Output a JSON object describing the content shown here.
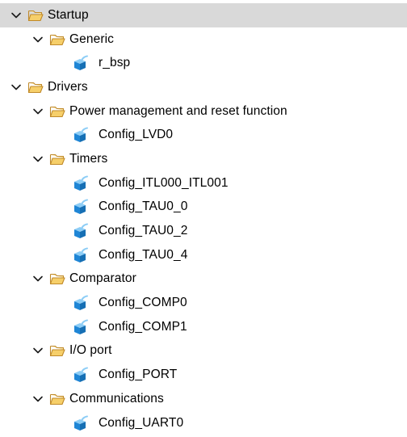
{
  "tree": [
    {
      "label": "Startup",
      "kind": "folder",
      "depth": 0,
      "expanded": true,
      "selected": true
    },
    {
      "label": "Generic",
      "kind": "folder",
      "depth": 1,
      "expanded": true
    },
    {
      "label": "r_bsp",
      "kind": "component",
      "depth": 2
    },
    {
      "label": "Drivers",
      "kind": "folder",
      "depth": 0,
      "expanded": true
    },
    {
      "label": "Power management and reset function",
      "kind": "folder",
      "depth": 1,
      "expanded": true
    },
    {
      "label": "Config_LVD0",
      "kind": "component",
      "depth": 2
    },
    {
      "label": "Timers",
      "kind": "folder",
      "depth": 1,
      "expanded": true
    },
    {
      "label": "Config_ITL000_ITL001",
      "kind": "component",
      "depth": 2
    },
    {
      "label": "Config_TAU0_0",
      "kind": "component",
      "depth": 2
    },
    {
      "label": "Config_TAU0_2",
      "kind": "component",
      "depth": 2
    },
    {
      "label": "Config_TAU0_4",
      "kind": "component",
      "depth": 2
    },
    {
      "label": "Comparator",
      "kind": "folder",
      "depth": 1,
      "expanded": true
    },
    {
      "label": "Config_COMP0",
      "kind": "component",
      "depth": 2
    },
    {
      "label": "Config_COMP1",
      "kind": "component",
      "depth": 2
    },
    {
      "label": "I/O port",
      "kind": "folder",
      "depth": 1,
      "expanded": true
    },
    {
      "label": "Config_PORT",
      "kind": "component",
      "depth": 2
    },
    {
      "label": "Communications",
      "kind": "folder",
      "depth": 1,
      "expanded": true
    },
    {
      "label": "Config_UART0",
      "kind": "component",
      "depth": 2
    }
  ],
  "icons": {
    "chevron": "chevron-down-icon",
    "folder": "folder-open-icon",
    "component": "component-cube-icon"
  },
  "colors": {
    "selection": "#d9d9d9",
    "folder_fill": "#f6d27a",
    "folder_stroke": "#c8922a",
    "cube_blue": "#1e88d8",
    "cube_light": "#7cc4f4"
  }
}
